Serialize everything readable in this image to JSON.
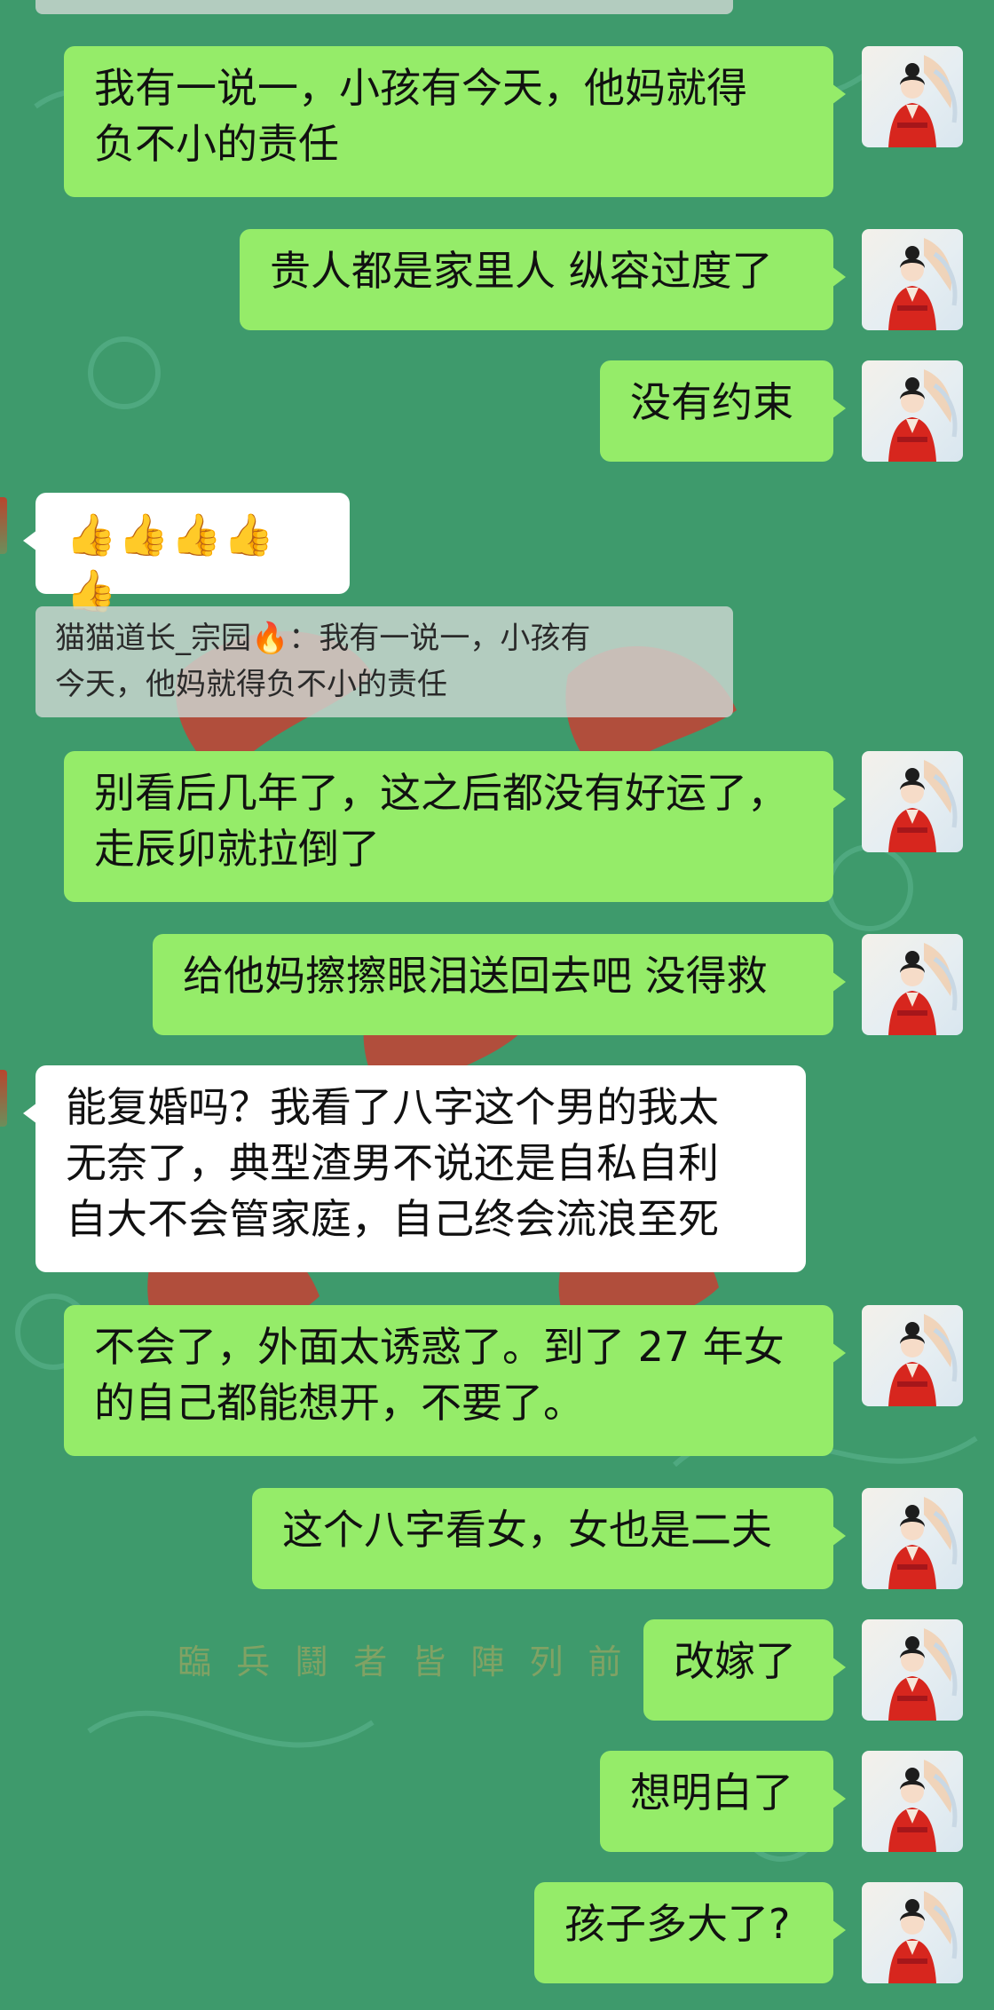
{
  "colors": {
    "background": "#3e9a6c",
    "outgoing_bubble": "#95ec69",
    "incoming_bubble": "#ffffff",
    "quote_block": "#cdd7d2"
  },
  "background": {
    "seal_text": "臨 兵 鬪 者 皆 陣 列 前"
  },
  "self_avatar_icon": "woman-in-red-hanfu-avatar",
  "messages": [
    {
      "side": "out",
      "text": "我有一说一，小孩有今天，他妈就得\n负不小的责任"
    },
    {
      "side": "out",
      "text": "贵人都是家里人 纵容过度了"
    },
    {
      "side": "out",
      "text": "没有约束"
    },
    {
      "side": "in",
      "text": "👍👍👍👍👍"
    },
    {
      "side": "quote",
      "text": "猫猫道长_宗园🔥：我有一说一，小孩有\n今天，他妈就得负不小的责任"
    },
    {
      "side": "out",
      "text": "别看后几年了，这之后都没有好运了，\n走辰卯就拉倒了"
    },
    {
      "side": "out",
      "text": "给他妈擦擦眼泪送回去吧 没得救"
    },
    {
      "side": "in",
      "text": "能复婚吗？我看了八字这个男的我太\n无奈了，典型渣男不说还是自私自利\n自大不会管家庭，自己终会流浪至死"
    },
    {
      "side": "out",
      "text": "不会了，外面太诱惑了。到了 27 年女\n的自己都能想开，不要了。"
    },
    {
      "side": "out",
      "text": "这个八字看女，女也是二夫"
    },
    {
      "side": "out",
      "text": "改嫁了"
    },
    {
      "side": "out",
      "text": "想明白了"
    },
    {
      "side": "out",
      "text": "孩子多大了?"
    }
  ]
}
